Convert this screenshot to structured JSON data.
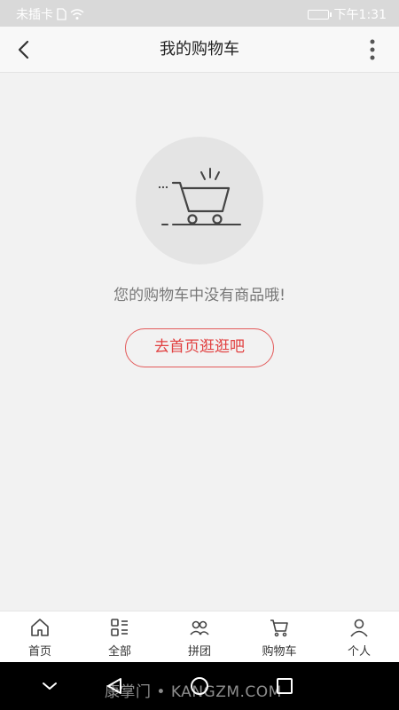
{
  "status_bar": {
    "carrier": "未插卡",
    "time": "下午1:31"
  },
  "header": {
    "title": "我的购物车"
  },
  "empty_state": {
    "message": "您的购物车中没有商品哦!",
    "button_label": "去首页逛逛吧"
  },
  "tabbar": {
    "items": [
      {
        "label": "首页",
        "icon": "home-icon"
      },
      {
        "label": "全部",
        "icon": "category-list-icon"
      },
      {
        "label": "拼团",
        "icon": "group-users-icon"
      },
      {
        "label": "购物车",
        "icon": "cart-icon"
      },
      {
        "label": "个人",
        "icon": "person-icon"
      }
    ]
  },
  "watermark": "康掌门 • KANGZM.COM",
  "colors": {
    "accent": "#e14040",
    "background": "#f2f2f2",
    "status_bar": "#d9d9d9"
  }
}
